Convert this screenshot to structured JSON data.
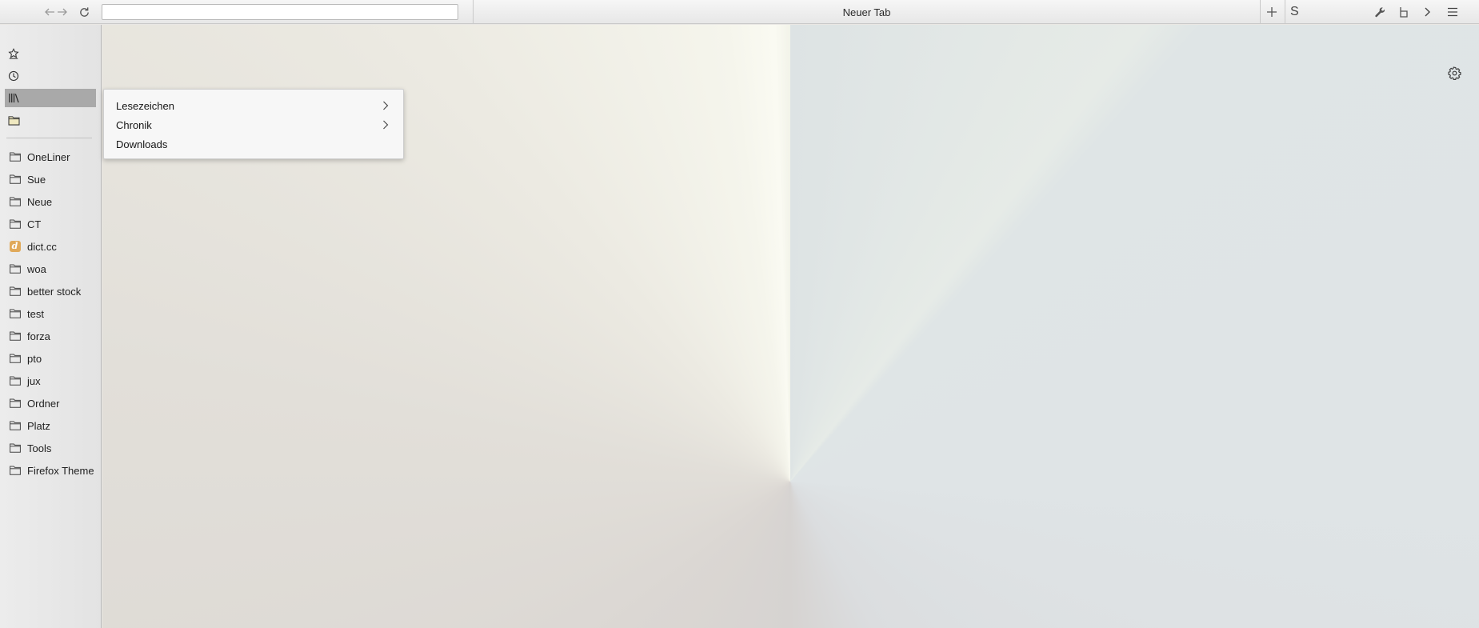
{
  "toolbar": {
    "url_value": "",
    "tab_title": "Neuer Tab",
    "extension_label": "S",
    "icons": [
      "arrow-back-icon",
      "arrow-forward-icon",
      "reload-icon",
      "plus-icon",
      "wrench-icon",
      "chevron-right-icon",
      "hamburger-icon"
    ]
  },
  "sidebar": {
    "icons": [
      "star-icon",
      "history-clock-icon",
      "library-icon",
      "folder-icon"
    ],
    "selected": "library-icon",
    "bookmarks": [
      {
        "label": "OneLiner",
        "icon": "folder-icon"
      },
      {
        "label": "Sue",
        "icon": "folder-icon"
      },
      {
        "label": "Neue",
        "icon": "folder-icon"
      },
      {
        "label": "CT",
        "icon": "folder-icon"
      },
      {
        "label": "dict.cc",
        "icon": "dict-cc-icon",
        "favicon_letter": "d"
      },
      {
        "label": "woa",
        "icon": "folder-icon"
      },
      {
        "label": "better stock",
        "icon": "folder-icon"
      },
      {
        "label": "test",
        "icon": "folder-icon"
      },
      {
        "label": "forza",
        "icon": "folder-icon"
      },
      {
        "label": "pto",
        "icon": "folder-icon"
      },
      {
        "label": "jux",
        "icon": "folder-icon"
      },
      {
        "label": "Ordner",
        "icon": "folder-icon"
      },
      {
        "label": "Platz",
        "icon": "folder-icon"
      },
      {
        "label": "Tools",
        "icon": "folder-icon"
      },
      {
        "label": "Firefox Theme",
        "icon": "folder-icon"
      }
    ]
  },
  "popup_menu": {
    "items": [
      {
        "label": "Lesezeichen",
        "has_submenu": true
      },
      {
        "label": "Chronik",
        "has_submenu": true
      },
      {
        "label": "Downloads",
        "has_submenu": false
      }
    ]
  },
  "colors": {
    "sidebar_selected": "#a9a9a9",
    "dict_cc_badge": "#e0a95a"
  }
}
